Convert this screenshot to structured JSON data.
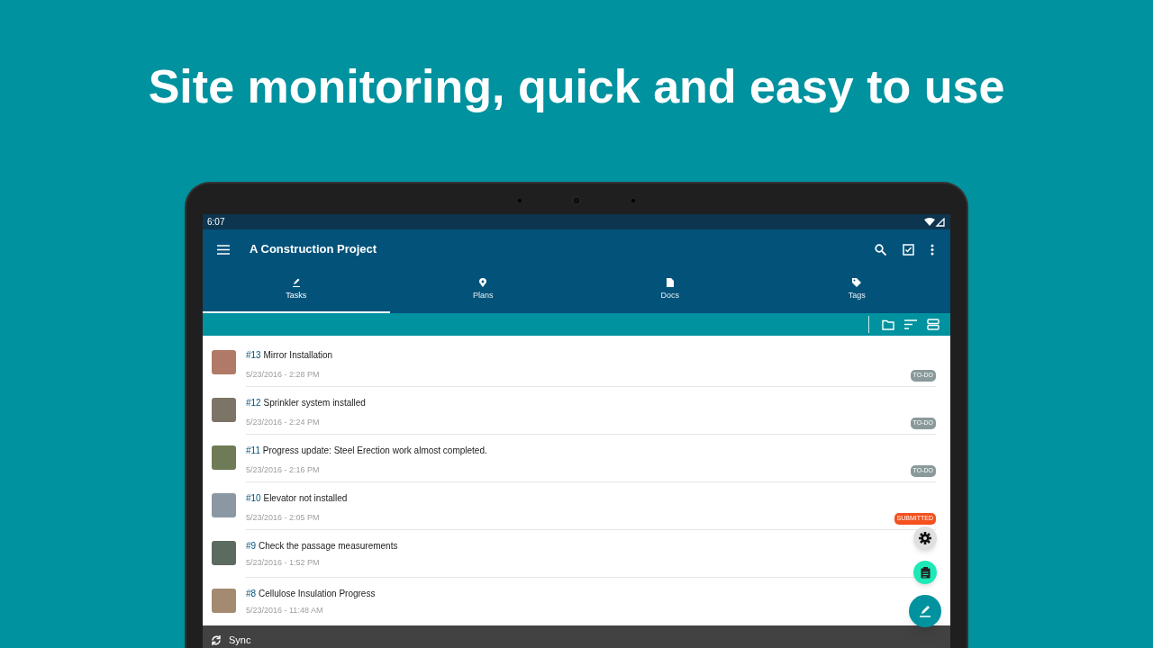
{
  "headline": "Site monitoring, quick and easy to use",
  "status_bar": {
    "time": "6:07"
  },
  "app_bar": {
    "title": "A Construction Project"
  },
  "tabs": [
    {
      "label": "Tasks",
      "kind": "pencil",
      "selected": true
    },
    {
      "label": "Plans",
      "kind": "pin",
      "selected": false
    },
    {
      "label": "Docs",
      "kind": "doc",
      "selected": false
    },
    {
      "label": "Tags",
      "kind": "tag",
      "selected": false
    }
  ],
  "tasks": [
    {
      "number": "#13",
      "title": "Mirror Installation",
      "date": "5/23/2016 - 2:28 PM",
      "status": "TO-DO",
      "color": "#8a9a9a"
    },
    {
      "number": "#12",
      "title": "Sprinkler system installed",
      "date": "5/23/2016 - 2:24 PM",
      "status": "TO-DO",
      "color": "#8a9a9a"
    },
    {
      "number": "#11",
      "title": "Progress update: Steel Erection work almost completed.",
      "date": "5/23/2016 - 2:16 PM",
      "status": "TO-DO",
      "color": "#8a9a9a"
    },
    {
      "number": "#10",
      "title": "Elevator not installed",
      "date": "5/23/2016 - 2:05 PM",
      "status": "SUBMITTED",
      "color": "#f4511e"
    },
    {
      "number": "#9",
      "title": "Check the passage measurements",
      "date": "5/23/2016 - 1:52 PM"
    },
    {
      "number": "#8",
      "title": "Cellulose Insulation Progress",
      "date": "5/23/2016 - 11:48 AM"
    }
  ],
  "sync_bar": {
    "label": "Sync"
  }
}
